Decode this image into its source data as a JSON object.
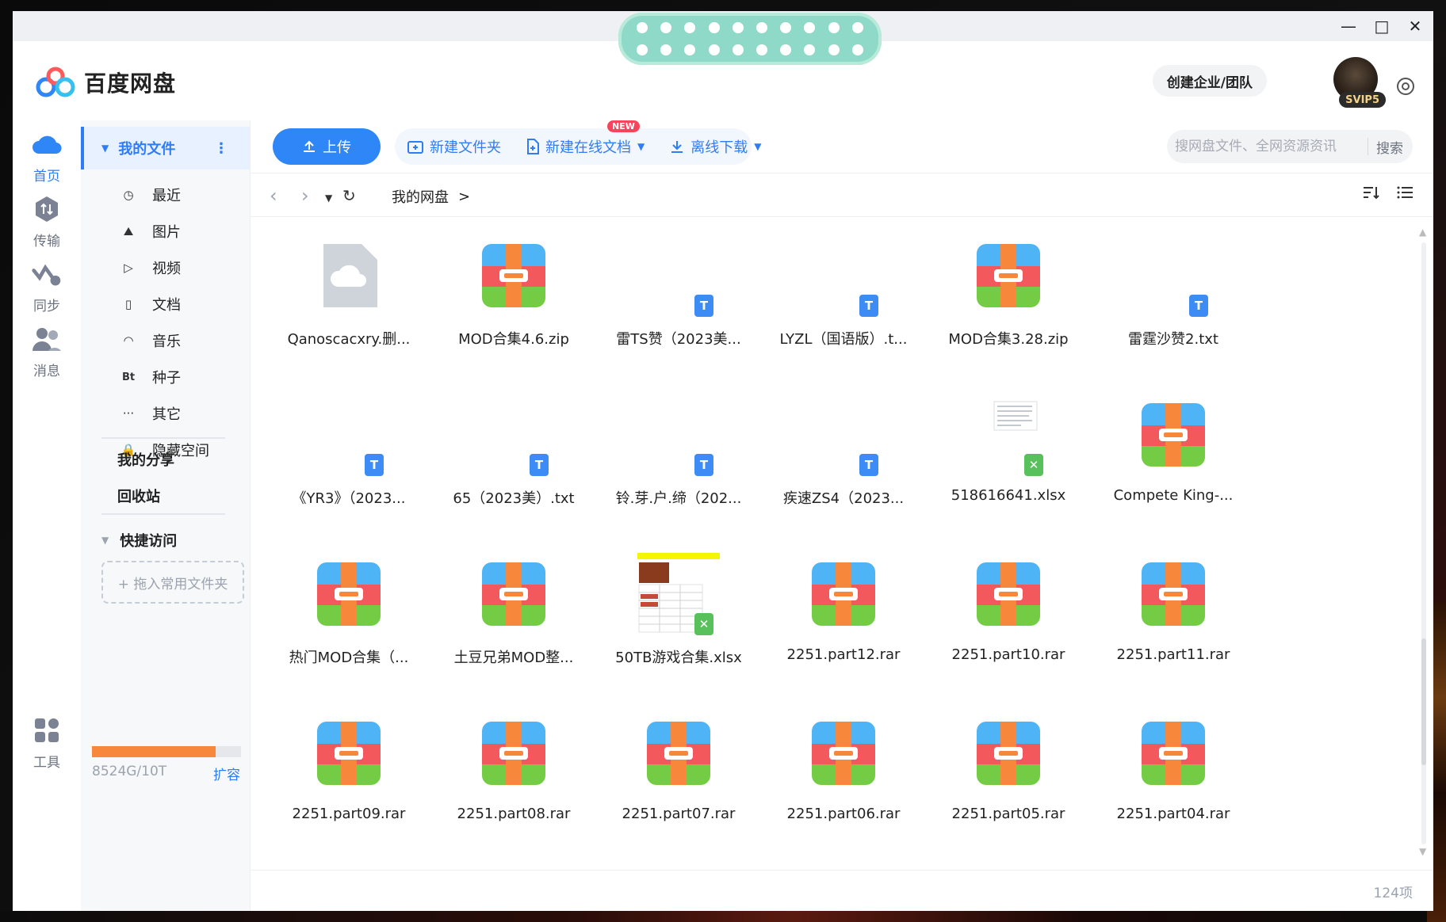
{
  "window": {
    "minimize": "—",
    "maximize": "□",
    "close": "✕"
  },
  "header": {
    "app_name": "百度网盘",
    "create_team": "创建企业/团队",
    "vip_badge": "SVIP5"
  },
  "rail": [
    {
      "label": "首页",
      "icon": "cloud-icon",
      "active": true
    },
    {
      "label": "传输",
      "icon": "transfer-icon",
      "active": false
    },
    {
      "label": "同步",
      "icon": "sync-icon",
      "active": false
    },
    {
      "label": "消息",
      "icon": "message-icon",
      "active": false
    },
    {
      "label": "工具",
      "icon": "tools-icon",
      "active": false
    }
  ],
  "sidebar": {
    "root": "我的文件",
    "items": [
      {
        "label": "最近",
        "icon": "clock-icon",
        "glyph": "◷"
      },
      {
        "label": "图片",
        "icon": "image-icon",
        "glyph": "⛰"
      },
      {
        "label": "视频",
        "icon": "play-icon",
        "glyph": "▷"
      },
      {
        "label": "文档",
        "icon": "document-icon",
        "glyph": "▯"
      },
      {
        "label": "音乐",
        "icon": "headphones-icon",
        "glyph": "◠"
      },
      {
        "label": "种子",
        "icon": "torrent-icon",
        "glyph": "Bt"
      },
      {
        "label": "其它",
        "icon": "more-icon",
        "glyph": "···"
      },
      {
        "label": "隐藏空间",
        "icon": "lock-icon",
        "glyph": "🔒"
      }
    ],
    "my_share": "我的分享",
    "recycle": "回收站",
    "quick_access": "快捷访问",
    "drop_hint": "+ 拖入常用文件夹",
    "quota_text": "8524G/10T",
    "quota_fraction": 0.83,
    "expand": "扩容"
  },
  "toolbar": {
    "upload": "上传",
    "new_folder": "新建文件夹",
    "new_online_doc": "新建在线文档",
    "new_badge": "NEW",
    "offline_download": "离线下载",
    "search_placeholder": "搜网盘文件、全网资源资讯",
    "search_button": "搜索"
  },
  "breadcrumb": {
    "root": "我的网盘",
    "sep": ">"
  },
  "files": [
    {
      "name": "Qanoscacxry.删...",
      "type": "cloud"
    },
    {
      "name": "MOD合集4.6.zip",
      "type": "archive"
    },
    {
      "name": "雷TS赞（2023美...",
      "type": "txt"
    },
    {
      "name": "LYZL（国语版）.t...",
      "type": "txt"
    },
    {
      "name": "MOD合集3.28.zip",
      "type": "archive"
    },
    {
      "name": "雷霆沙赞2.txt",
      "type": "txt"
    },
    {
      "name": "《YR3》（2023...",
      "type": "txt"
    },
    {
      "name": "65（2023美）.txt",
      "type": "txt"
    },
    {
      "name": "铃.芽.户.缔（202...",
      "type": "txt"
    },
    {
      "name": "疾速ZS4（2023...",
      "type": "txt"
    },
    {
      "name": "518616641.xlsx",
      "type": "xlsx-doc"
    },
    {
      "name": "Compete King-...",
      "type": "archive"
    },
    {
      "name": "热门MOD合集（...",
      "type": "archive"
    },
    {
      "name": "土豆兄弟MOD整...",
      "type": "archive"
    },
    {
      "name": "50TB游戏合集.xlsx",
      "type": "xlsx-sheet"
    },
    {
      "name": "2251.part12.rar",
      "type": "archive"
    },
    {
      "name": "2251.part10.rar",
      "type": "archive"
    },
    {
      "name": "2251.part11.rar",
      "type": "archive"
    },
    {
      "name": "2251.part09.rar",
      "type": "archive"
    },
    {
      "name": "2251.part08.rar",
      "type": "archive"
    },
    {
      "name": "2251.part07.rar",
      "type": "archive"
    },
    {
      "name": "2251.part06.rar",
      "type": "archive"
    },
    {
      "name": "2251.part05.rar",
      "type": "archive"
    },
    {
      "name": "2251.part04.rar",
      "type": "archive"
    }
  ],
  "footer": {
    "count": "124项"
  },
  "colors": {
    "accent": "#2f7cf6",
    "archive_orange": "#f7873a"
  }
}
